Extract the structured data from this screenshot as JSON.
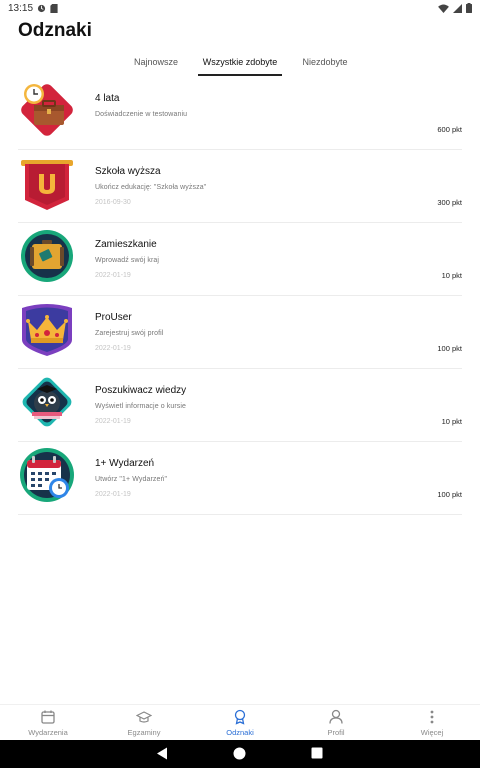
{
  "status_bar": {
    "time": "13:15"
  },
  "page": {
    "title": "Odznaki"
  },
  "tabs": [
    {
      "label": "Najnowsze",
      "active": false
    },
    {
      "label": "Wszystkie zdobyte",
      "active": true
    },
    {
      "label": "Niezdobyte",
      "active": false
    }
  ],
  "badges": [
    {
      "title": "4 lata",
      "description": "Doświadczenie w testowaniu",
      "date": "",
      "points": "600 pkt",
      "icon": "briefcase-clock-icon"
    },
    {
      "title": "Szkoła wyższa",
      "description": "Ukończ edukację: \"Szkoła wyższa\"",
      "date": "2016-09-30",
      "points": "300 pkt",
      "icon": "university-banner-icon"
    },
    {
      "title": "Zamieszkanie",
      "description": "Wprowadź swój kraj",
      "date": "2022-01-19",
      "points": "10 pkt",
      "icon": "suitcase-icon"
    },
    {
      "title": "ProUser",
      "description": "Zarejestruj swój profil",
      "date": "2022-01-19",
      "points": "100 pkt",
      "icon": "crown-icon"
    },
    {
      "title": "Poszukiwacz wiedzy",
      "description": "Wyświetl informacje o kursie",
      "date": "2022-01-19",
      "points": "10 pkt",
      "icon": "owl-books-icon"
    },
    {
      "title": "1+ Wydarzeń",
      "description": "Utwórz \"1+ Wydarzeń\"",
      "date": "2022-01-19",
      "points": "100 pkt",
      "icon": "calendar-clock-icon"
    }
  ],
  "bottom_nav": [
    {
      "label": "Wydarzenia",
      "icon": "calendar-icon",
      "active": false
    },
    {
      "label": "Egzaminy",
      "icon": "graduation-cap-icon",
      "active": false
    },
    {
      "label": "Odznaki",
      "icon": "badge-icon",
      "active": true
    },
    {
      "label": "Profil",
      "icon": "person-icon",
      "active": false
    },
    {
      "label": "Więcej",
      "icon": "more-vertical-icon",
      "active": false
    }
  ],
  "colors": {
    "accent": "#2b6fd6",
    "text": "#111111",
    "muted": "#777777"
  }
}
